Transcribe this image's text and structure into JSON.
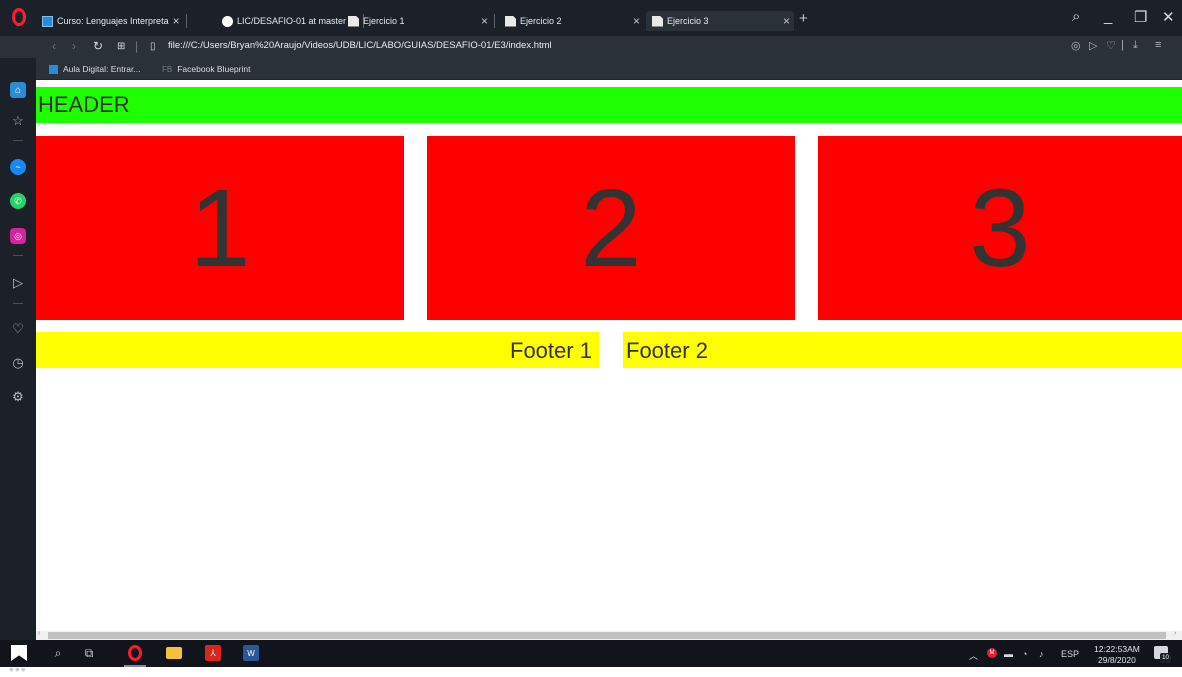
{
  "browser": {
    "tabs": [
      {
        "title": "Curso: Lenguajes Interpreta",
        "icon": "aula-digital-icon",
        "active": false
      },
      {
        "title": "LIC/DESAFIO-01 at master",
        "icon": "github-icon",
        "active": false
      },
      {
        "title": "Ejercicio 1",
        "icon": "document-icon",
        "active": false
      },
      {
        "title": "Ejercicio 2",
        "icon": "document-icon",
        "active": false
      },
      {
        "title": "Ejercicio 3",
        "icon": "document-icon",
        "active": true
      }
    ],
    "close_glyph": "×",
    "new_tab_glyph": "+",
    "url": "file:///C:/Users/Bryan%20Araujo/Videos/UDB/LIC/LABO/GUIAS/DESAFIO-01/E3/index.html",
    "bookmarks": [
      {
        "label": "Aula Digital: Entrar...",
        "icon": "aula-digital-icon"
      },
      {
        "label": "Facebook Blueprint",
        "prefix": "FB"
      }
    ]
  },
  "page": {
    "header": "HEADER",
    "boxes": [
      "1",
      "2",
      "3"
    ],
    "footer": [
      "Footer 1",
      "Footer 2"
    ]
  },
  "taskbar": {
    "language": "ESP",
    "time": "12:22:53AM",
    "date": "29/8/2020",
    "notification_count": "10"
  },
  "colors": {
    "header_bg": "#1eff00",
    "box_bg": "#ff0000",
    "footer_bg": "#ffff00",
    "text": "#333333",
    "browser_dark": "#1c2129",
    "opera_red": "#ff1b2d"
  }
}
